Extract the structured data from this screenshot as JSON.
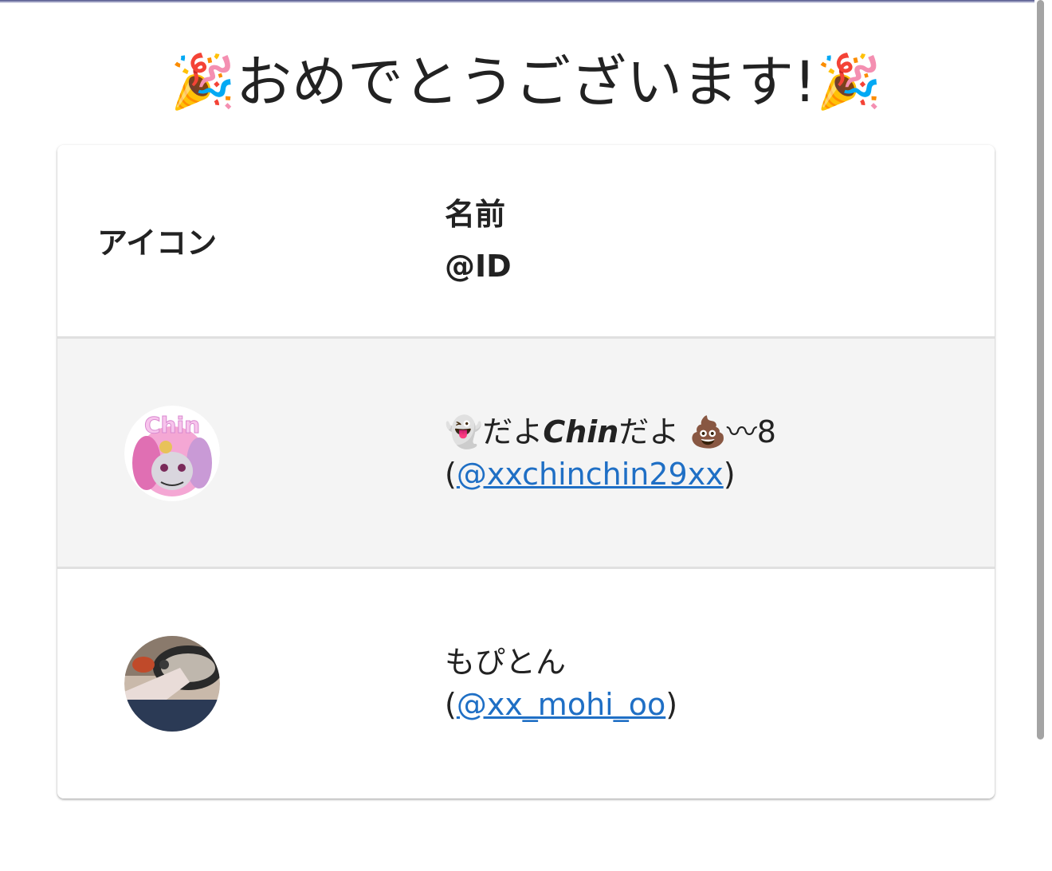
{
  "page": {
    "title": "おめでとうございます!",
    "title_emoji": "🎉"
  },
  "table": {
    "headers": {
      "icon": "アイコン",
      "name": "名前",
      "id": "@ID"
    },
    "rows": [
      {
        "name_prefix": "👻だよ",
        "name_latin": "Chin",
        "name_suffix": "だよ 💩〰8",
        "id_link": "@xxchinchin29xx",
        "avatar_text": "Chin",
        "avatar_colors": [
          "#f4a7d4",
          "#e06fb3",
          "#ffffff"
        ]
      },
      {
        "name": "もぴとん",
        "id_link": "@xx_mohi_oo",
        "avatar_colors": [
          "#5a4a3f",
          "#2b3a55",
          "#c9b9aa"
        ]
      }
    ],
    "paren_open": "(",
    "paren_close": ")"
  },
  "colors": {
    "link": "#1f6fc5",
    "row_stripe": "#f4f4f4",
    "divider": "#e0e0e0"
  }
}
